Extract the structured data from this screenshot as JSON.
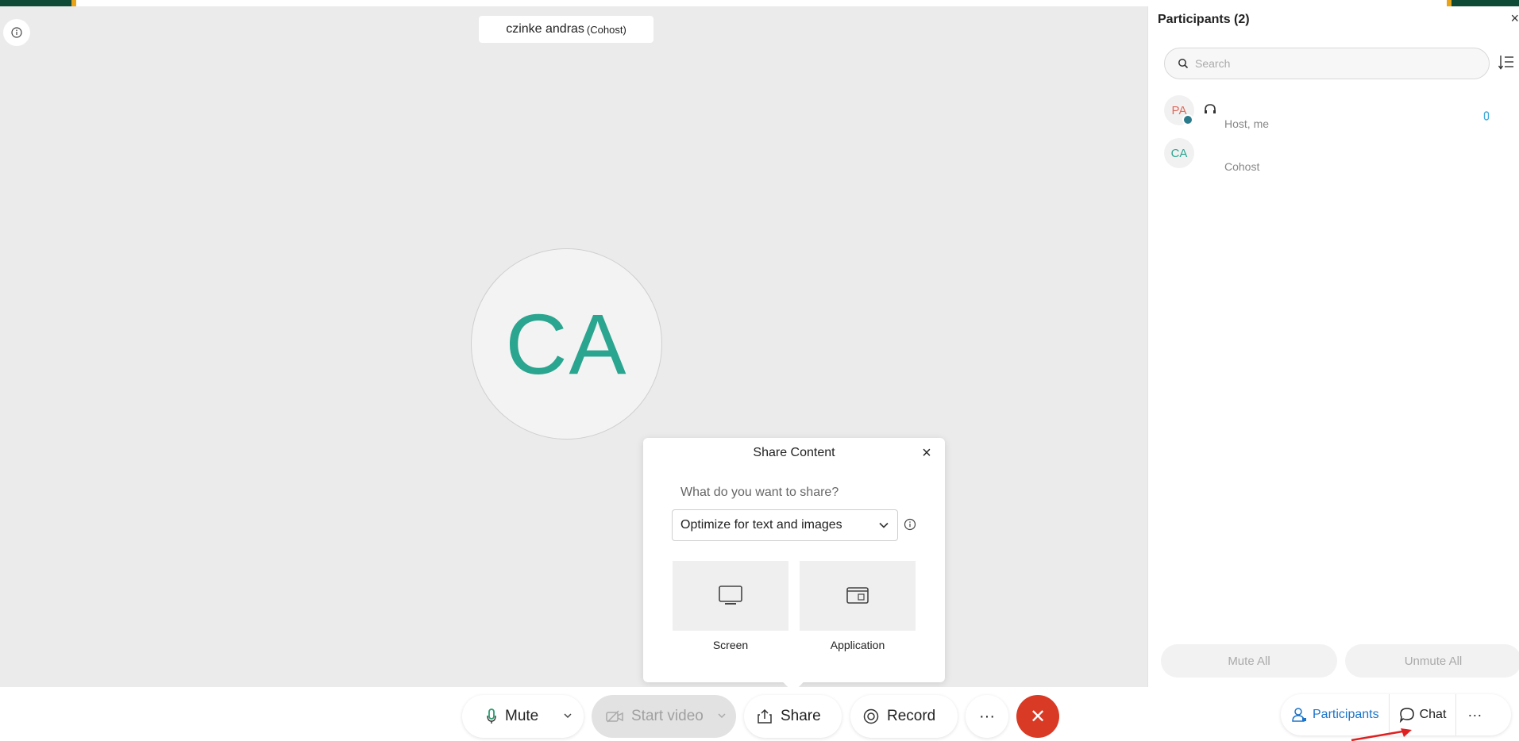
{
  "stage": {
    "name_tag": {
      "name": "czinke andras",
      "role": "(Cohost)"
    },
    "big_avatar_initials": "CA"
  },
  "share_popup": {
    "title": "Share Content",
    "close_icon": "×",
    "question": "What do you want to share?",
    "optimize_selected": "Optimize for text and images",
    "tiles": {
      "screen": "Screen",
      "application": "Application"
    }
  },
  "toolbar": {
    "mute": "Mute",
    "start_video": "Start video",
    "share": "Share",
    "record": "Record",
    "more": "···",
    "end": "✕"
  },
  "participants_panel": {
    "title": "Participants (2)",
    "close_icon": "×",
    "search_placeholder": "Search",
    "participants": [
      {
        "initials": "PA",
        "role": "Host, me"
      },
      {
        "initials": "CA",
        "role": "Cohost"
      }
    ],
    "mute_all": "Mute All",
    "unmute_all": "Unmute All"
  },
  "right_tabs": {
    "participants": "Participants",
    "chat": "Chat",
    "more": "···"
  },
  "colors": {
    "brand_green": "#0e4a36",
    "brand_gold": "#e8a317",
    "avatar_teal": "#2aa58f",
    "end_red": "#d93a25",
    "link_blue": "#1b74c9"
  }
}
